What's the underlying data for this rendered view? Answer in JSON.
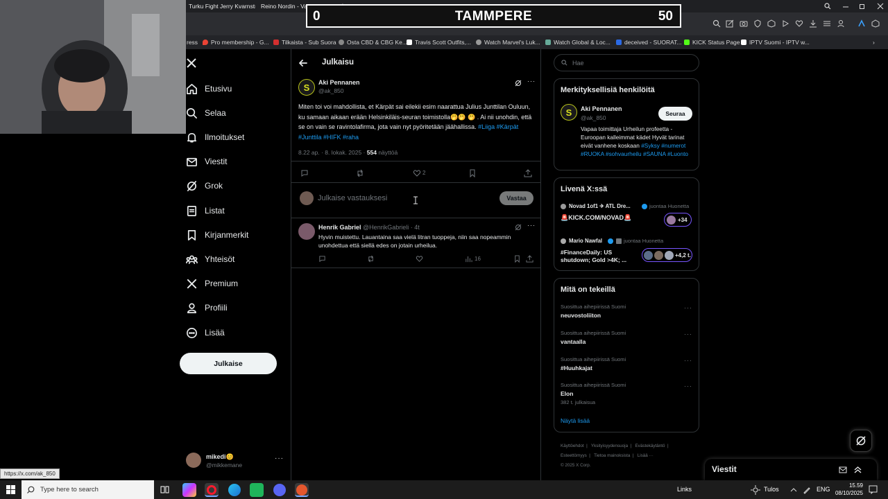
{
  "browser": {
    "tabs": [
      "Turku Fight Jerry Kvarnstr...",
      "Reino Nordin - Vasemmi..."
    ],
    "bookmarks": [
      "Pro membership - G...",
      "Tilkaista - Sub Suora",
      "Osta CBD & CBG Ke...",
      "Travis Scott Outfits,...",
      "Watch Marvel's Luk...",
      "Watch Global & Loc...",
      "deceived - SUORAT...",
      "KICK Status Page",
      "IPTV Suomi - IPTV w..."
    ],
    "prefix": "ress"
  },
  "overlay": {
    "home_score": "0",
    "city": "TAMMPERE",
    "away_score": "50"
  },
  "nav": {
    "items": [
      "Etusivu",
      "Selaa",
      "Ilmoitukset",
      "Viestit",
      "Grok",
      "Listat",
      "Kirjanmerkit",
      "Yhteisöt",
      "Premium",
      "Profiili",
      "Lisää"
    ],
    "post_label": "Julkaise"
  },
  "account": {
    "name": "mikedi😊",
    "handle": "@mikkemane"
  },
  "main": {
    "header_title": "Julkaisu",
    "tweet": {
      "author": "Aki Pennanen",
      "handle": "@ak_850",
      "text": "Miten toi voi mahdollista, et Kärpät sai eilekii esim naarattua Julius Junttilan Ouluun, ku samaan aikaan erään Helsinkiläis-seuran toimistolla🤭🤭 🤭 . Ai nii unohdin, että se on vain se ravintolafirma, jota vain nyt pyöritetään jäähallissa.",
      "hashtags": "#Liiga #Kärpät #Junttila #HIFK #raha",
      "time": "8.22 ap. · 8. lokak. 2025 · ",
      "views": "554",
      "views_label": " näyttöä",
      "likes": "2"
    },
    "reply_placeholder": "Julkaise vastauksesi",
    "reply_button": "Vastaa",
    "reply": {
      "author": "Henrik Gabriel",
      "meta": "@HenrikGabrieli · 4t",
      "text": "Hyvin muistettu. Lauantaina saa vielä litran tuoppeja, niin saa nopeammin unohdettua että siellä edes on jotain urheilua.",
      "views": "16"
    }
  },
  "right": {
    "search_placeholder": "Hae",
    "relevant": {
      "title": "Merkityksellisiä henkilöitä",
      "name": "Aki Pennanen",
      "handle": "@ak_850",
      "follow": "Seuraa",
      "bio": "Vapaa toimittaja Urheilun profeetta - Euroopan kalleimmat kädet Hyvät tarinat eivät vanhene koskaan",
      "bio_tags1": "#Syksy",
      "bio_tags2": "#numerot #RUOKA #sohvaurheilu",
      "bio_tags3": "#SAUNA #Luonto"
    },
    "live": {
      "title": "Livenä X:ssä",
      "items": [
        {
          "host": "Novad 1of1 ✈ ATL Dre...",
          "status": "juontaa Huonetta",
          "text": "🚨KICK.COM/NOVAD🚨",
          "count": "+34"
        },
        {
          "host": "Mario Nawfal",
          "status": "juontaa Huonetta",
          "text": "#FinanceDaily: US shutdown; Gold >4K; ...",
          "count": "+4,2 t."
        }
      ]
    },
    "trends": {
      "title": "Mitä on tekeillä",
      "items": [
        {
          "meta": "Suosittua aihepiirissä Suomi",
          "name": "neuvostoliiton",
          "posts": ""
        },
        {
          "meta": "Suosittua aihepiirissä Suomi",
          "name": "vantaalla",
          "posts": ""
        },
        {
          "meta": "Suosittua aihepiirissä Suomi",
          "name": "#Huuhkajat",
          "posts": ""
        },
        {
          "meta": "Suosittua aihepiirissä Suomi",
          "name": "Elon",
          "posts": "382 t. julkaisua"
        }
      ],
      "show_more": "Näytä lisää"
    },
    "footer": {
      "line1": [
        "Käyttöehdot",
        "Yksityisyydensuoja",
        "Evästekäytäntö"
      ],
      "line2": [
        "Esteettömyys",
        "Tietoa mainoksista",
        "Lisää ···"
      ],
      "copyright": "© 2025 X Corp."
    }
  },
  "messages_dock": {
    "title": "Viestit"
  },
  "url_tooltip": "https://x.com/ak_850",
  "taskbar": {
    "search_placeholder": "Type here to search",
    "links": "Links",
    "weather": "Tulos",
    "lang": "ENG",
    "time": "15.59",
    "date": "08/10/2025"
  },
  "colors": {
    "accent": "#1d9bf0",
    "border": "#2f3336",
    "muted": "#71767b",
    "text": "#e7e9ea",
    "live": "#7856ff"
  }
}
